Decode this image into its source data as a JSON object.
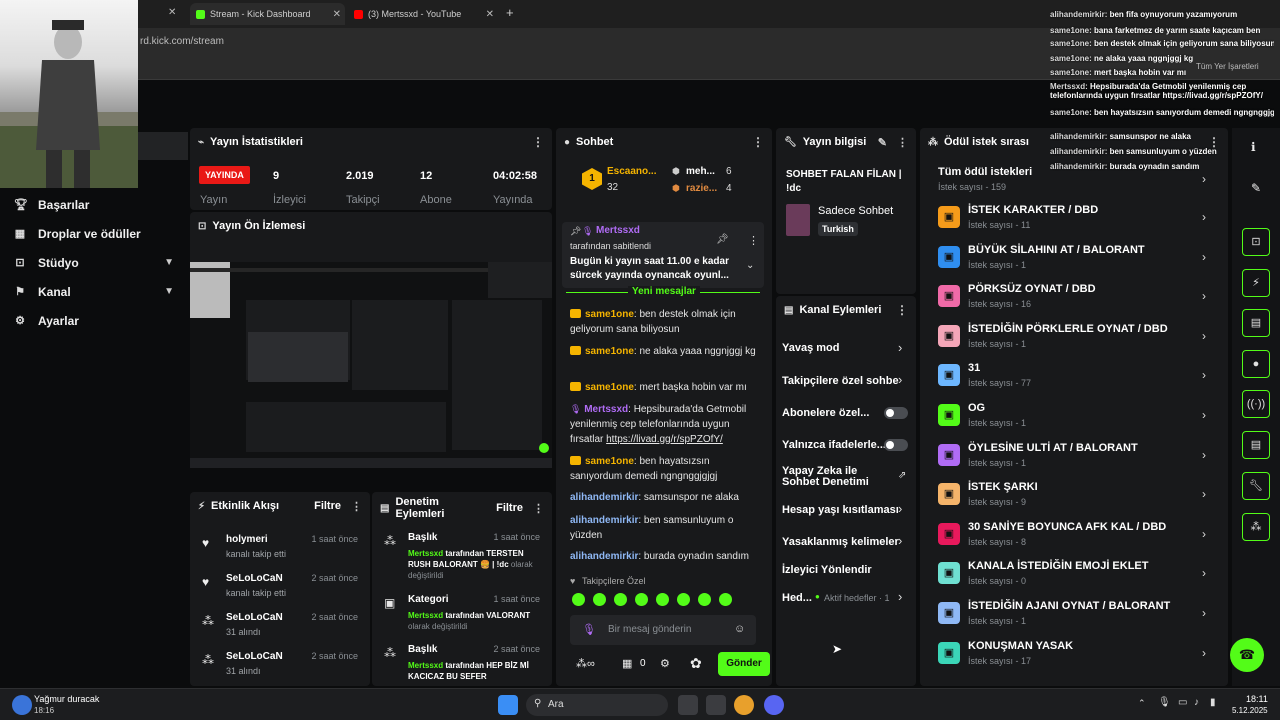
{
  "browser": {
    "tabs": [
      {
        "title": "Stream - Kick Dashboard"
      },
      {
        "title": "(3) Mertssxd - YouTube"
      }
    ],
    "url": "rd.kick.com/stream",
    "bookmark": "Tüm Yer İşaretleri"
  },
  "nav": {
    "items": [
      {
        "label": "Başarılar",
        "icon": "trophy-icon"
      },
      {
        "label": "Droplar ve ödüller",
        "icon": "gift-icon"
      },
      {
        "label": "Stüdyo",
        "icon": "studio-icon"
      },
      {
        "label": "Kanal",
        "icon": "channel-icon"
      },
      {
        "label": "Ayarlar",
        "icon": "gear-icon"
      }
    ]
  },
  "stats": {
    "title": "Yayın İstatistikleri",
    "live_badge": "YAYINDA",
    "live_label": "Yayın",
    "viewers": "9",
    "viewers_label": "İzleyici",
    "followers": "2.019",
    "followers_label": "Takipçi",
    "subs": "12",
    "subs_label": "Abone",
    "uptime": "04:02:58",
    "uptime_label": "Yayında"
  },
  "preview": {
    "title": "Yayın Ön İzlemesi"
  },
  "activity": {
    "title": "Etkinlik Akışı",
    "filter": "Filtre",
    "items": [
      {
        "name": "holymeri",
        "desc": "kanalı takip etti",
        "time": "1 saat önce"
      },
      {
        "name": "SeLoLoCaN",
        "desc": "kanalı takip etti",
        "time": "2 saat önce"
      },
      {
        "name": "SeLoLoCaN",
        "desc": "31 alındı",
        "time": "2 saat önce"
      },
      {
        "name": "SeLoLoCaN",
        "desc": "31 alındı",
        "time": "2 saat önce"
      }
    ]
  },
  "moderation": {
    "title": "Denetim Eylemleri",
    "filter": "Filtre",
    "items": [
      {
        "title": "Başlık",
        "time": "1 saat önce",
        "user": "Mertssxd",
        "text1": "tarafından TERSTEN RUSH BALORANT 🍔 | !dc",
        "text2": "olarak değiştirildi"
      },
      {
        "title": "Kategori",
        "time": "1 saat önce",
        "user": "Mertssxd",
        "text1": "tarafından VALORANT",
        "text2": "olarak değiştirildi"
      },
      {
        "title": "Başlık",
        "time": "2 saat önce",
        "user": "Mertssxd",
        "text1": "tarafından HEP BİZ",
        "text2": "Mİ KACICAZ BU SEFER"
      }
    ]
  },
  "chat": {
    "title": "Sohbet",
    "top": [
      {
        "name": "Escaano...",
        "count": "32"
      },
      {
        "name": "meh...",
        "count": "6"
      },
      {
        "name": "razie...",
        "count": "4"
      }
    ],
    "pinned_user": "Mertssxd",
    "pinned_by": "tarafından sabitlendi",
    "pinned_text": "Bugün ki yayın saat 11.00 e kadar sürcek yayında oynancak oyunl...",
    "new_messages": "Yeni mesajlar",
    "messages": [
      {
        "user": "same1one",
        "text": "ben destek olmak için geliyorum sana biliyosun"
      },
      {
        "user": "same1one",
        "text": "ne alaka yaaa nggnjggj kg"
      },
      {
        "user": "same1one",
        "text": "mert başka hobin var mı"
      },
      {
        "user": "Mertssxd",
        "text": "Hepsiburada'da Getmobil yenilenmiş cep telefonlarında uygun fırsatlar ",
        "link": "https://livad.gg/r/spPZOfY/"
      },
      {
        "user": "same1one",
        "text": "ben hayatsızsın sanıyordum demedi ngngnggjgjgj"
      },
      {
        "user": "alihandemirkir",
        "text": "samsunspor ne alaka"
      },
      {
        "user": "alihandemirkir",
        "text": "ben samsunluyum o yüzden"
      },
      {
        "user": "alihandemirkir",
        "text": "burada oynadın sandım"
      }
    ],
    "followers_only": "Takipçilere Özel",
    "input_placeholder": "Bir mesaj gönderin",
    "points": "0",
    "send": "Gönder"
  },
  "stream_info": {
    "title": "Yayın bilgisi",
    "stream_title": "SOHBET FALAN FİLAN | !dc",
    "category": "Sadece Sohbet",
    "language": "Turkish"
  },
  "channel_actions": {
    "title": "Kanal Eylemleri",
    "items": [
      {
        "label": "Yavaş mod"
      },
      {
        "label": "Takipçilere özel sohbe"
      },
      {
        "label": "Abonelere özel..."
      },
      {
        "label": "Yalnızca ifadelerle..."
      },
      {
        "label": "Yapay Zeka ile Sohbet Denetimi"
      },
      {
        "label": "Hesap yaşı kısıtlaması"
      },
      {
        "label": "Yasaklanmış kelimeler"
      },
      {
        "label": "İzleyici Yönlendir"
      },
      {
        "label": "Hed...",
        "sub": "Aktif hedefler · 1"
      }
    ]
  },
  "rewards": {
    "title": "Ödül istek sırası",
    "all_title": "Tüm ödül istekleri",
    "all_count": "İstek sayısı - 159",
    "items": [
      {
        "title": "İSTEK KARAKTER / DBD",
        "count": "İstek sayısı - 11",
        "color": "#f59b1a"
      },
      {
        "title": "BÜYÜK SİLAHINI AT / BALORANT",
        "count": "İstek sayısı - 1",
        "color": "#2f8ef0"
      },
      {
        "title": "PÖRKSÜZ OYNAT / DBD",
        "count": "İstek sayısı - 16",
        "color": "#f06aa8"
      },
      {
        "title": "İSTEDİĞİN PÖRKLERLE OYNAT / DBD",
        "count": "İstek sayısı - 1",
        "color": "#f4a6b8"
      },
      {
        "title": "31",
        "count": "İstek sayısı - 77",
        "color": "#6db7ff"
      },
      {
        "title": "OG",
        "count": "İstek sayısı - 1",
        "color": "#53fc18"
      },
      {
        "title": "ÖYLESİNE ULTİ AT / BALORANT",
        "count": "İstek sayısı - 1",
        "color": "#b06cf5"
      },
      {
        "title": "İSTEK ŞARKI",
        "count": "İstek sayısı - 9",
        "color": "#f5b46a"
      },
      {
        "title": "30 SANİYE BOYUNCA AFK KAL / DBD",
        "count": "İstek sayısı - 8",
        "color": "#e8195c"
      },
      {
        "title": "KANALA İSTEDİĞİN EMOJİ EKLET",
        "count": "İstek sayısı - 0",
        "color": "#6fe0d2"
      },
      {
        "title": "İSTEDİĞİN AJANI OYNAT / BALORANT",
        "count": "İstek sayısı - 1",
        "color": "#8fb8f5"
      },
      {
        "title": "KONUŞMAN YASAK",
        "count": "İstek sayısı - 17",
        "color": "#3bd6b8"
      }
    ]
  },
  "overlay_chat": [
    {
      "user": "alihandemirkir:",
      "text": "ben fifa oynuyorum yazamıyorum"
    },
    {
      "user": "same1one:",
      "text": "bana farketmez de yarım saate kaçıcam ben"
    },
    {
      "user": "same1one:",
      "text": "ben destek olmak için geliyorum sana biliyosun"
    },
    {
      "user": "same1one:",
      "text": "ne alaka yaaa nggnjggj kg"
    },
    {
      "user": "same1one:",
      "text": "mert başka hobin var mı"
    },
    {
      "user": "Mertssxd:",
      "text": "Hepsiburada'da Getmobil yenilenmiş cep telefonlarında uygun fırsatlar https://livad.gg/r/spPZOfY/"
    },
    {
      "user": "same1one:",
      "text": "ben hayatsızsın sanıyordum demedi ngngnggjgjgj"
    },
    {
      "user": "alihandemirkir:",
      "text": "samsunspor ne alaka"
    },
    {
      "user": "alihandemirkir:",
      "text": "ben samsunluyum o yüzden"
    },
    {
      "user": "alihandemirkir:",
      "text": "burada oynadın sandım"
    }
  ],
  "taskbar": {
    "weather": "Yağmur duracak",
    "weather_time": "18:16",
    "search": "Ara",
    "time": "18:11",
    "date": "5.12.2025"
  },
  "colors": {
    "accent": "#53fc18",
    "live": "#e91916",
    "panel": "#18191b",
    "bg": "#0b0c0d"
  }
}
